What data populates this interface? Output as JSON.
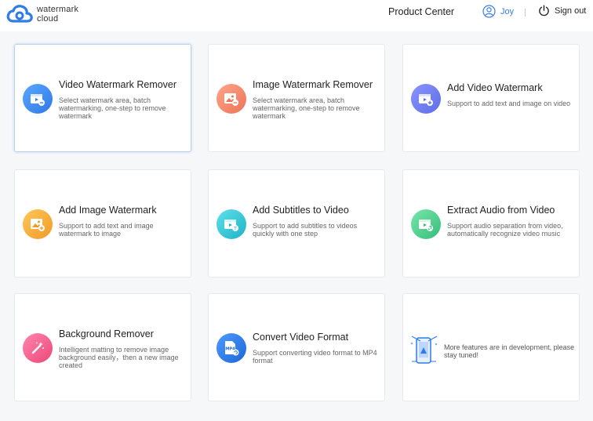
{
  "header": {
    "logo_line1": "watermark",
    "logo_line2": "cloud",
    "product_center": "Product Center",
    "user_name": "Joy",
    "sign_out": "Sign out"
  },
  "cards": [
    {
      "title": "Video Watermark Remover",
      "desc": "Select watermark area, batch watermarking, one-step to remove watermark",
      "icon": "video-remove-icon",
      "color": "#3a86f0"
    },
    {
      "title": "Image Watermark Remover",
      "desc": "Select watermark area, batch watermarking, one-step to remove watermark",
      "icon": "image-remove-icon",
      "color": "#f0876a"
    },
    {
      "title": "Add Video Watermark",
      "desc": "Support to add text and image on video",
      "icon": "video-add-icon",
      "color": "#6f7df0"
    },
    {
      "title": "Add Image Watermark",
      "desc": "Support to add text and image watermark to image",
      "icon": "image-add-icon",
      "color": "#f5b03a"
    },
    {
      "title": "Add Subtitles to Video",
      "desc": "Support to add subtitles to videos quickly with one step",
      "icon": "subtitle-icon",
      "color": "#2fc4d4"
    },
    {
      "title": "Extract Audio from Video",
      "desc": "Support audio separation from video, automatically recognize video music",
      "icon": "audio-extract-icon",
      "color": "#4fcf8f"
    },
    {
      "title": "Background Remover",
      "desc": "Intelligent matting to remove image background easily，then a new image created",
      "icon": "magic-wand-icon",
      "color": "#f05b8a"
    },
    {
      "title": "Convert Video Format",
      "desc": "Support converting video format to MP4 format",
      "icon": "mp4-convert-icon",
      "color": "#2f7be8"
    }
  ],
  "more": {
    "text": "More features are in development, please stay tuned!",
    "icon": "phone-construction-icon"
  },
  "mp4_label": "MP4"
}
